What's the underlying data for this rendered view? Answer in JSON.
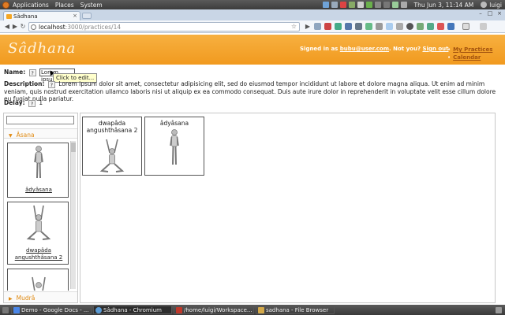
{
  "top_panel": {
    "menus": [
      "Applications",
      "Places",
      "System"
    ],
    "clock": "Thu Jun  3, 11:14 AM",
    "user": "luigi"
  },
  "browser": {
    "tab_title": "Sâdhana",
    "url_host": "localhost",
    "url_rest": ":3000/practices/14"
  },
  "header": {
    "logo": "Sâdhana",
    "signed_prefix": "Signed in as ",
    "email": "bubu@user.com",
    "not_you": ". Not you? ",
    "signout": "Sign out",
    "links": [
      "My Practices",
      "Calendar"
    ]
  },
  "form": {
    "name_label": "Name:",
    "name_value": "Lorem ipsum",
    "tooltip": "Click to edit...",
    "description_label": "Description:",
    "description": "Lorem ipsum dolor sit amet, consectetur adipisicing elit, sed do eiusmod tempor incididunt ut labore et dolore magna aliqua. Ut enim ad minim veniam, quis nostrud exercitation ullamco laboris nisi ut aliquip ex ea commodo consequat. Duis aute irure dolor in reprehenderit in voluptate velit esse cillum dolore eu fugiat nulla pariatur.",
    "delay_label": "Delay:",
    "delay_value": "1",
    "help_mark": "?"
  },
  "sidebar": {
    "section_asana": "Âsana",
    "section_mudra": "Mudrâ",
    "palette": [
      {
        "name": "âdyâsana",
        "pose": "standing"
      },
      {
        "name": "dwapâda angushthâsana 2",
        "pose": "kneeling-arms-up"
      },
      {
        "name": "",
        "pose": "partial"
      }
    ]
  },
  "practice": {
    "items": [
      {
        "name": "dwapâda angushthâsana 2",
        "pose": "kneeling-arms-up"
      },
      {
        "name": "âdyâsana",
        "pose": "standing"
      }
    ]
  },
  "taskbar": {
    "tasks": [
      {
        "label": "Demo - Google Docs - ...",
        "color": "#4a86e8"
      },
      {
        "label": "Sâdhana - Chromium",
        "color": "#5b9bd5"
      },
      {
        "label": "/home/luigi/Workspace...",
        "color": "#c0392b"
      },
      {
        "label": "sadhana - File Browser",
        "color": "#d4a94a"
      }
    ]
  },
  "colors": {
    "header_orange": "#f19a1f",
    "link_brown": "#a2520e",
    "section_orange": "#e08a12"
  }
}
